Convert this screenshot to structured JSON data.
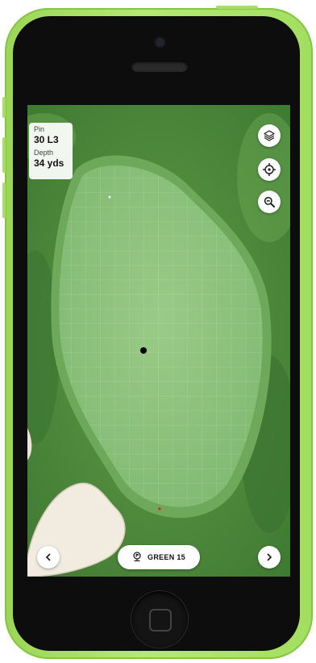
{
  "info": {
    "pin_label": "Pin",
    "pin_value": "30 L3",
    "depth_label": "Depth",
    "depth_value": "34 yds"
  },
  "controls": {
    "layers_icon": "layers-icon",
    "locate_icon": "crosshair-icon",
    "zoom_icon": "zoom-out-icon",
    "prev_icon": "chevron-left-icon",
    "next_icon": "chevron-right-icon"
  },
  "green_selector": {
    "icon": "flag-pin-icon",
    "label": "GREEN 15"
  },
  "colors": {
    "device_shell": "#a9e36a",
    "fairway": "#4f8b3d",
    "green_surface": "#8fc47f",
    "bunker": "#f1ebe0",
    "pin_marker": "#000000"
  }
}
